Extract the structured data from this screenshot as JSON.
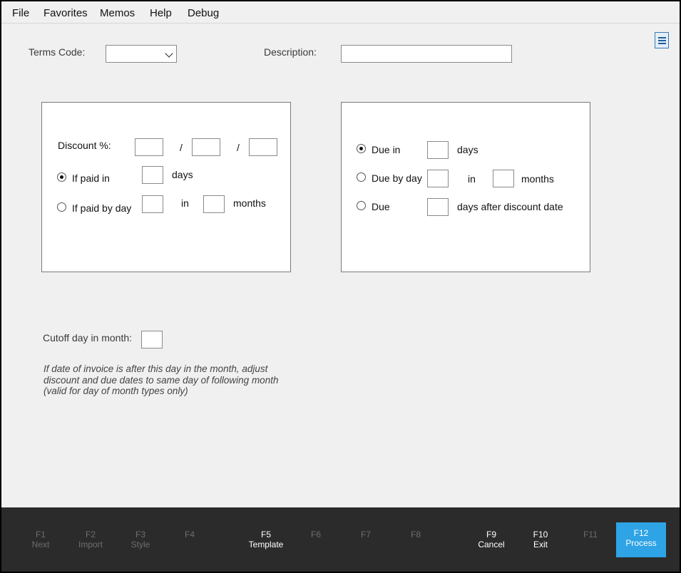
{
  "menu": {
    "file": "File",
    "favorites": "Favorites",
    "memos": "Memos",
    "help": "Help",
    "debug": "Debug"
  },
  "header": {
    "terms_code_label": "Terms Code:",
    "terms_code_value": "",
    "description_label": "Description:",
    "description_value": ""
  },
  "discount_panel": {
    "discount_label": "Discount %:",
    "separator": "/",
    "discount_values": [
      "",
      "",
      ""
    ],
    "if_paid_in_label": "If paid in",
    "if_paid_in_selected": true,
    "if_paid_in_value": "",
    "days_label": "days",
    "if_paid_by_day_label": "If paid by day",
    "if_paid_by_day_selected": false,
    "if_paid_by_day_value": "",
    "in_label": "in",
    "months_value": "",
    "months_label": "months"
  },
  "due_panel": {
    "due_in_label": "Due in",
    "due_in_selected": true,
    "due_in_value": "",
    "days_label": "days",
    "due_by_day_label": "Due by day",
    "due_by_day_selected": false,
    "due_by_day_value": "",
    "in_label": "in",
    "months_value": "",
    "months_label": "months",
    "due_label": "Due",
    "due_selected": false,
    "due_after_value": "",
    "days_after_label": "days after discount date"
  },
  "cutoff": {
    "label": "Cutoff day in month:",
    "value": "",
    "note": "If date of invoice is after this day in the month, adjust discount and due dates to same day of following month (valid for day of month types only)"
  },
  "fkeys": [
    {
      "key": "F1",
      "name": "Next"
    },
    {
      "key": "F2",
      "name": "Import"
    },
    {
      "key": "F3",
      "name": "Style"
    },
    {
      "key": "F4",
      "name": ""
    },
    {
      "key": "F5",
      "name": "Template"
    },
    {
      "key": "F6",
      "name": ""
    },
    {
      "key": "F7",
      "name": ""
    },
    {
      "key": "F8",
      "name": ""
    },
    {
      "key": "F9",
      "name": "Cancel"
    },
    {
      "key": "F10",
      "name": "Exit"
    },
    {
      "key": "F11",
      "name": ""
    },
    {
      "key": "F12",
      "name": "Process"
    }
  ],
  "icons": {
    "menu_toggle": "hamburger-icon",
    "dropdown": "chevron-down-icon"
  },
  "colors": {
    "primary_button": "#2ea3e6",
    "footer_bg": "#2b2b2b",
    "disabled_text": "#6e6e6e"
  }
}
